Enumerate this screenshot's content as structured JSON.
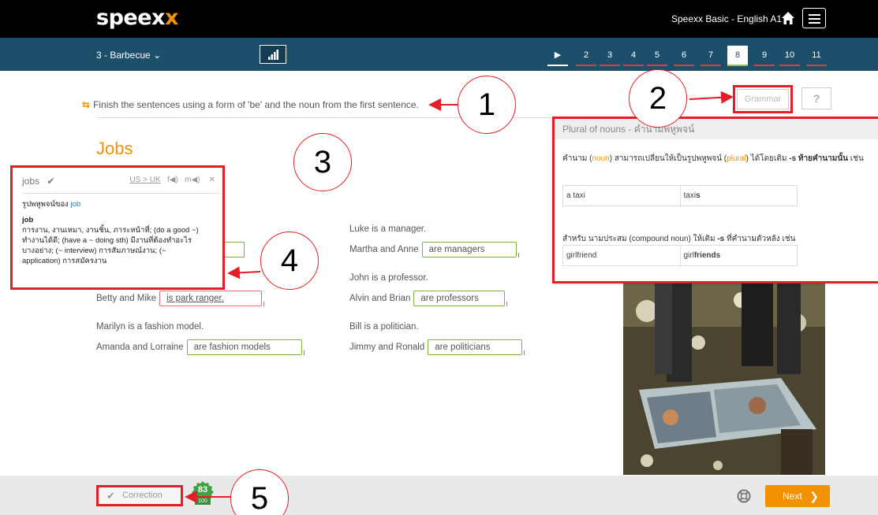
{
  "header": {
    "logo_main": "speex",
    "logo_accent": "x",
    "course_title": "Speexx Basic - English A1"
  },
  "nav": {
    "unit": "3 - Barbecue",
    "steps": [
      {
        "label": "▶",
        "state": "play"
      },
      {
        "label": "2",
        "state": "wrong"
      },
      {
        "label": "3",
        "state": "wrong"
      },
      {
        "label": "4",
        "state": "wrong"
      },
      {
        "label": "5",
        "state": "wrong"
      },
      {
        "label": "6",
        "state": "wrong"
      },
      {
        "label": "7",
        "state": "wrong"
      },
      {
        "label": "8",
        "state": "active"
      },
      {
        "label": "9",
        "state": "wrong"
      },
      {
        "label": "10",
        "state": "wrong"
      },
      {
        "label": "11",
        "state": "wrong"
      }
    ]
  },
  "exercise": {
    "instruction": "Finish the sentences using a form of 'be' and the noun from the first sentence.",
    "title": "Jobs",
    "items": [
      {
        "prompt": "Luke is a manager.",
        "subject": "Martha and Anne",
        "answer": "are managers",
        "correct": true
      },
      {
        "prompt": "John is a professor.",
        "subject": "Alvin and Brian",
        "answer": "are professors",
        "correct": true
      },
      {
        "prompt": "",
        "subject": "Betty and Mike",
        "answer": "is park ranger.",
        "correct": false
      },
      {
        "prompt": "Bill is a politician.",
        "subject": "Jimmy and Ronald",
        "answer": "are politicians",
        "correct": true
      },
      {
        "prompt": "Marilyn is a fashion model.",
        "subject": "Amanda and Lorraine",
        "answer": "are fashion models",
        "correct": true
      }
    ]
  },
  "toolbar": {
    "grammar_label": "Grammar",
    "help_label": "?"
  },
  "grammar_panel": {
    "title": "Plural of nouns - คำนามพหูพจน์",
    "rule1_a": "คำนาม (",
    "rule1_noun": "noun",
    "rule1_b": ") สามารถเปลี่ยนให้เป็นรูปพหูพจน์ (",
    "rule1_plural": "plural",
    "rule1_c": ") ได้โดยเติม ",
    "rule1_bold": "-s ท้ายคำนามนั้น",
    "rule1_d": " เช่น",
    "example1_singular": "a taxi",
    "example1_plural_stem": "taxi",
    "example1_plural_suffix": "s",
    "rule2_a": "สำหรับ นามประสม (compound noun) ให้เติม ",
    "rule2_bold": "-s",
    "rule2_b": " ที่คำนามตัวหลัง เช่น",
    "example2_singular": "girlfriend",
    "example2_plural_stem": "girl",
    "example2_plural_suffix": "friends"
  },
  "dictionary": {
    "word": "jobs",
    "check": "✔",
    "dialects": "US > UK",
    "audio_f": "f◀)",
    "audio_m": "m◀)",
    "close": "✕",
    "plural_of_label": "รูปพหูพจน์ของ",
    "plural_of_word": "job",
    "entry_word": "job",
    "entry_line1": "การงาน, งานเหมา, งานชิ้น, ภาระหน้าที่; (do a good ~)",
    "entry_line2": "ทำงานได้ดี; (have a ~ doing sth) มีงานที่ต้องทำอะไร",
    "entry_line3": "บางอย่าง; (~ interview) การสัมภาษณ์งาน; (~",
    "entry_line4": "application) การสมัครงาน"
  },
  "footer": {
    "correction_label": "Correction",
    "score": "83",
    "score_total": "100",
    "next_label": "Next"
  },
  "callouts": [
    "1",
    "2",
    "3",
    "4",
    "5"
  ],
  "colors": {
    "topbar": "#000000",
    "navbar": "#1d4f6b",
    "accent_orange": "#f39200",
    "highlight_red": "#e41e26",
    "correct_green": "#7cb342"
  }
}
